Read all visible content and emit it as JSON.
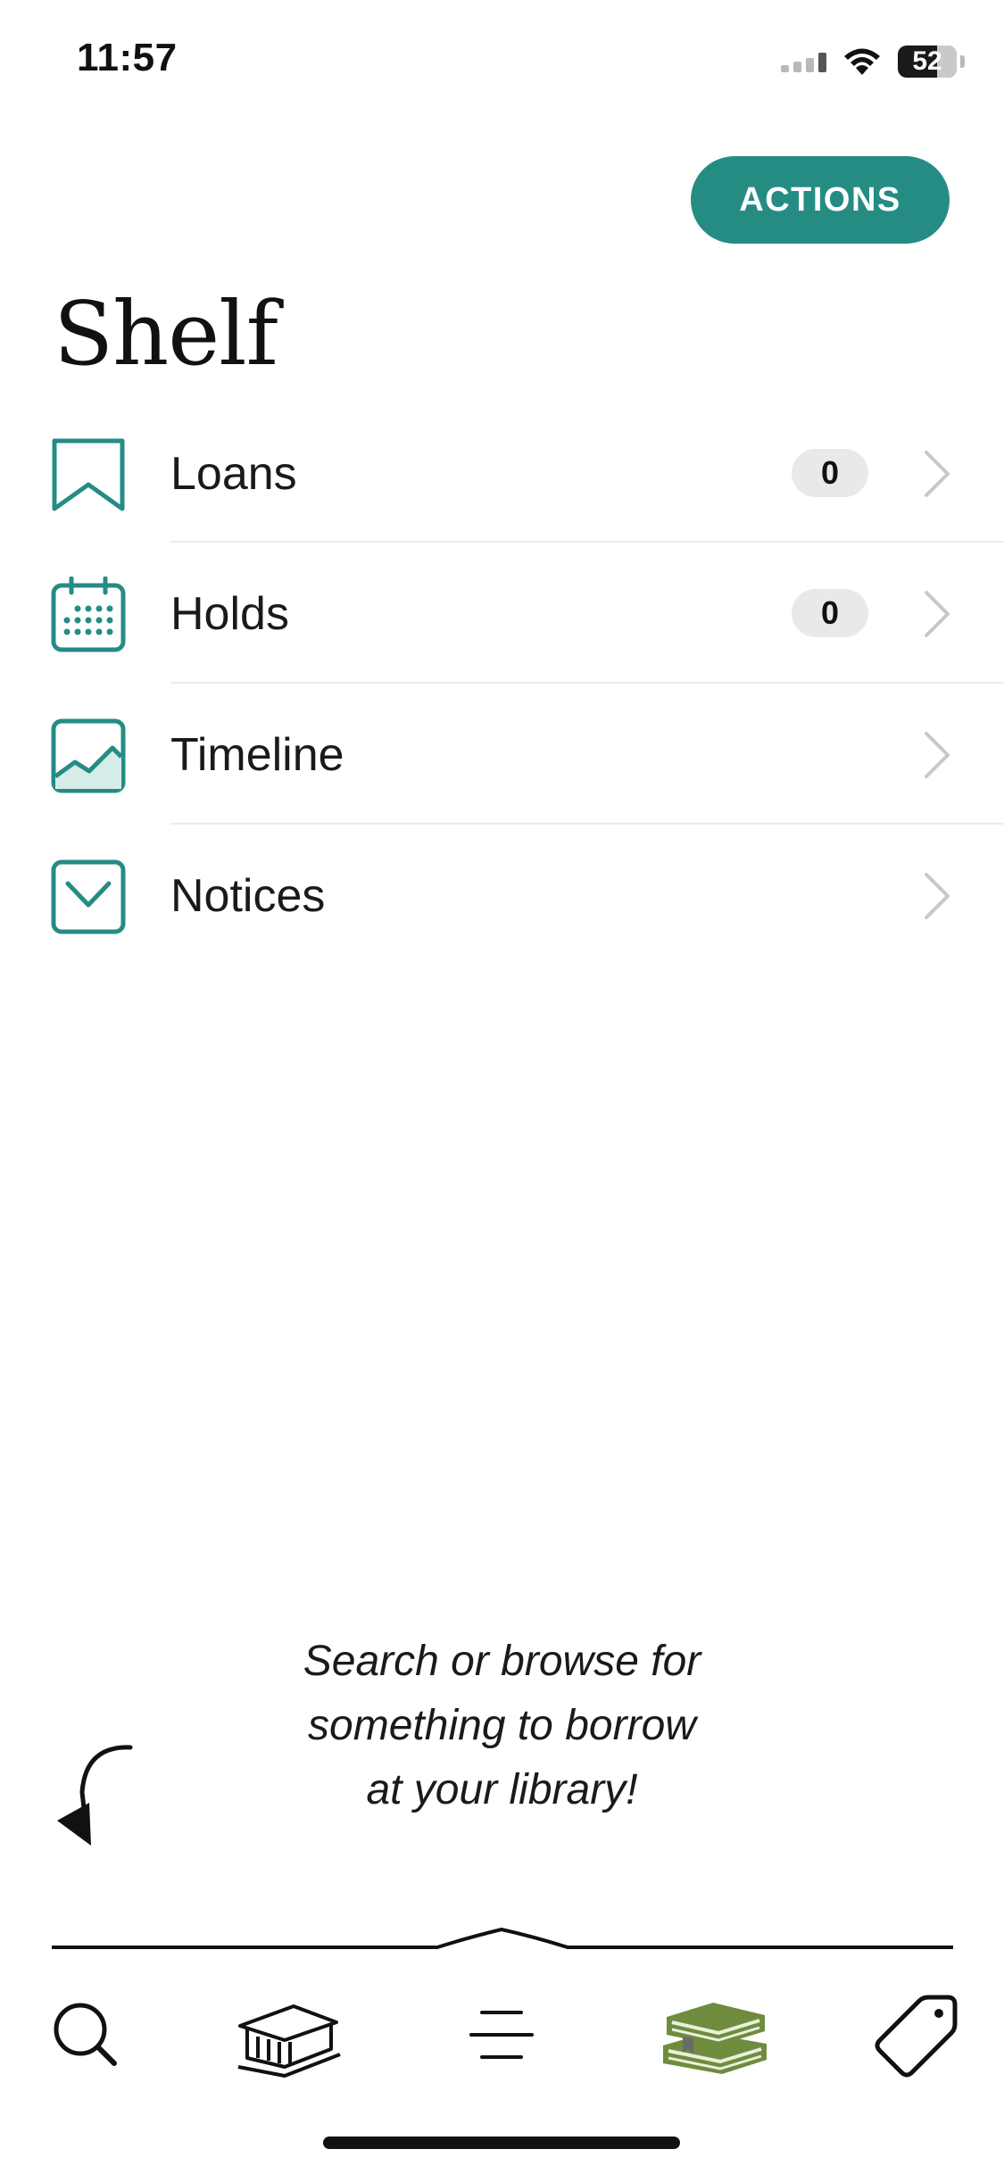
{
  "status_bar": {
    "time": "11:57",
    "battery": "52"
  },
  "header": {
    "actions_label": "ACTIONS"
  },
  "page": {
    "title": "Shelf"
  },
  "rows": [
    {
      "label": "Loans",
      "count": "0",
      "icon": "bookmark-icon"
    },
    {
      "label": "Holds",
      "count": "0",
      "icon": "calendar-icon"
    },
    {
      "label": "Timeline",
      "icon": "chart-icon"
    },
    {
      "label": "Notices",
      "icon": "envelope-icon"
    }
  ],
  "prompt": {
    "line1": "Search or browse for",
    "line2": "something to borrow",
    "line3": "at your library!"
  },
  "tab_bar": {
    "tabs": [
      {
        "icon": "search-icon"
      },
      {
        "icon": "library-icon"
      },
      {
        "icon": "menu-icon"
      },
      {
        "icon": "books-icon",
        "active": true
      },
      {
        "icon": "tag-icon"
      }
    ]
  },
  "colors": {
    "accent": "#258c84",
    "active_tab": "#6f8c3e"
  }
}
